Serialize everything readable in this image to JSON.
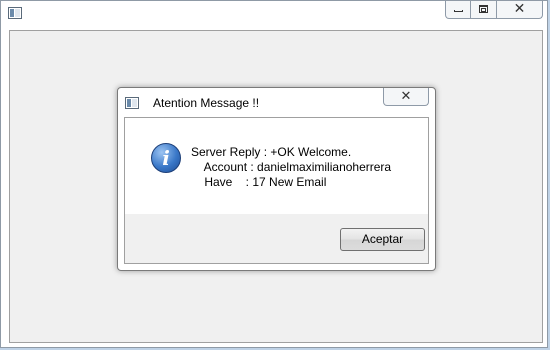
{
  "main_window": {
    "title": "",
    "controls": {
      "minimize": "minimize-icon",
      "maximize": "restore-icon",
      "close": "close-icon"
    }
  },
  "dialog": {
    "title": "Atention Message !!",
    "close_glyph": "✕",
    "icon": "info-icon",
    "message_lines": [
      "Server Reply : +OK Welcome.",
      "    Account : danielmaximilianoherrera",
      "    Have    : 17 New Email"
    ],
    "ok_label": "Aceptar"
  },
  "colors": {
    "info_blue": "#3a78c8",
    "dialog_background": "#f0f0f0"
  }
}
